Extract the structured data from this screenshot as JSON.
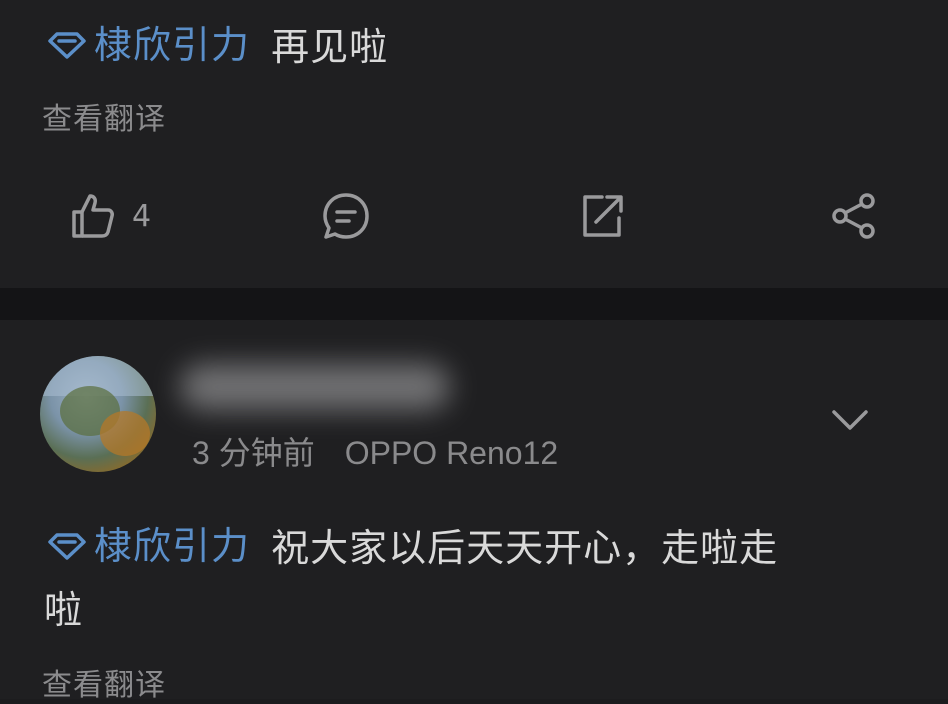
{
  "posts": [
    {
      "topic": "棣欣引力",
      "text": "再见啦",
      "translate_label": "查看翻译",
      "actions": {
        "like_count": "4",
        "icons": [
          "thumbs-up-icon",
          "comment-icon",
          "repost-icon",
          "share-icon"
        ]
      }
    },
    {
      "author_name_blurred": true,
      "time": "3 分钟前",
      "device": "OPPO Reno12",
      "topic": "棣欣引力",
      "text_line1": "祝大家以后天天开心，走啦走",
      "text_line2": "啦",
      "translate_label": "查看翻译"
    }
  ],
  "colors": {
    "background": "#1f1f21",
    "divider": "#141416",
    "topic": "#5b8fc9",
    "text": "#d9d9d9",
    "muted": "#8b8b8d"
  }
}
